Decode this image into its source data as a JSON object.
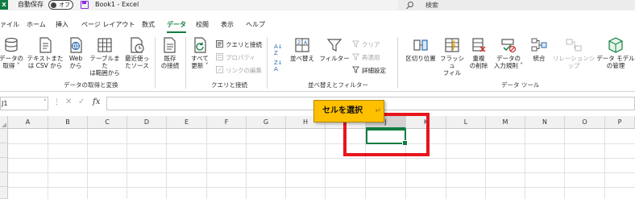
{
  "titlebar": {
    "app_icon": "X",
    "autosave_label": "自動保存",
    "autosave_state": "オフ",
    "window_title": "Book1 - Excel",
    "search_placeholder": "検索"
  },
  "tabs": [
    "ファイル",
    "ホーム",
    "挿入",
    "ページ レイアウト",
    "数式",
    "データ",
    "校閲",
    "表示",
    "ヘルプ"
  ],
  "active_tab": "データ",
  "ribbon": {
    "groups": {
      "get_data": "データの取得と変換",
      "queries": "クエリと接続",
      "sort_filter": "並べ替えとフィルター",
      "data_tools": "データ ツール"
    },
    "buttons": {
      "get_data": [
        "データの",
        "取得 ˅"
      ],
      "from_text": [
        "テキストまた",
        "は CSV から"
      ],
      "from_web": [
        "Web",
        "から"
      ],
      "from_table": [
        "テーブルまた",
        "は範囲から"
      ],
      "recent": [
        "最近使っ",
        "たソース"
      ],
      "existing": [
        "既存",
        "の接続"
      ],
      "refresh_all": [
        "すべて",
        "更新 ˅"
      ],
      "queries_connections": "クエリと接続",
      "properties": "プロパティ",
      "edit_links": "リンクの編集",
      "sort": "並べ替え",
      "filter": "フィルター",
      "clear": "クリア",
      "reapply": "再適用",
      "advanced": "詳細設定",
      "text_to_columns": "区切り位置",
      "flash_fill": [
        "フラッシュ",
        "フィル"
      ],
      "remove_duplicates": [
        "重複",
        "の削除"
      ],
      "data_validation": [
        "データの",
        "入力規則 ˅"
      ],
      "consolidate": "統合",
      "relationships": "リレーションシップ",
      "data_model": [
        "データ モデル",
        "の管理"
      ]
    }
  },
  "formula_bar": {
    "name_box": "J1",
    "fx": "fx",
    "formula": ""
  },
  "grid": {
    "columns": [
      "A",
      "B",
      "C",
      "D",
      "E",
      "F",
      "G",
      "H",
      "I",
      "J",
      "K",
      "L",
      "M",
      "N",
      "O",
      "P"
    ],
    "selected_column": "J"
  },
  "callout": {
    "text": "セルを選択",
    "mark": "↵"
  },
  "colors": {
    "accent": "#107c41",
    "highlight": "#e8141c",
    "callout": "#ffc000"
  }
}
